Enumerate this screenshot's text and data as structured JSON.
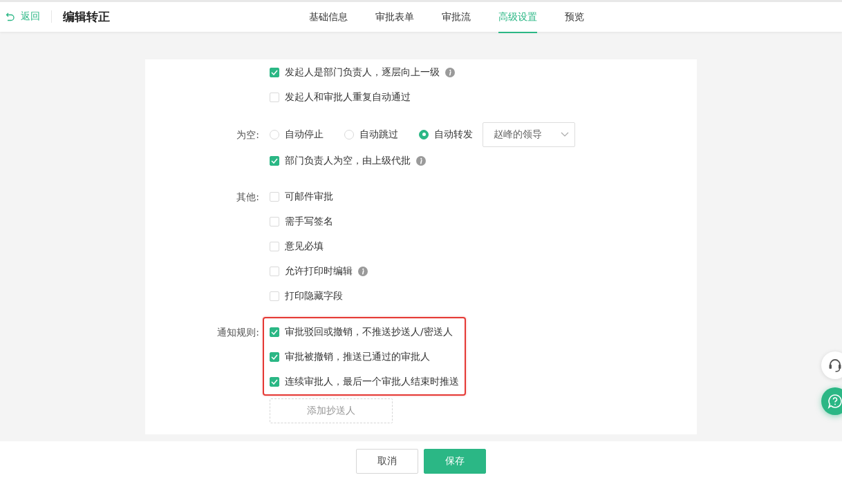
{
  "header": {
    "back": "返回",
    "title": "编辑转正",
    "tabs": [
      {
        "label": "基础信息",
        "selected": false
      },
      {
        "label": "审批表单",
        "selected": false
      },
      {
        "label": "审批流",
        "selected": false
      },
      {
        "label": "高级设置",
        "selected": true
      },
      {
        "label": "预览",
        "selected": false
      }
    ]
  },
  "sections": [
    {
      "items": [
        {
          "kind": "checkbox",
          "label": "发起人是部门负责人，逐层向上一级",
          "checked": true,
          "info": true
        },
        {
          "kind": "checkbox",
          "label": "发起人和审批人重复自动通过",
          "checked": false
        }
      ]
    },
    {
      "label": "为空:",
      "items": [
        {
          "kind": "radio_group",
          "options": [
            {
              "label": "自动停止",
              "selected": false
            },
            {
              "label": "自动跳过",
              "selected": false
            },
            {
              "label": "自动转发",
              "selected": true
            }
          ],
          "select": {
            "value": "赵峰的领导"
          }
        },
        {
          "kind": "checkbox",
          "label": "部门负责人为空，由上级代批",
          "checked": true,
          "info": true
        }
      ]
    },
    {
      "label": "其他:",
      "items": [
        {
          "kind": "checkbox",
          "label": "可邮件审批",
          "checked": false
        },
        {
          "kind": "checkbox",
          "label": "需手写签名",
          "checked": false
        },
        {
          "kind": "checkbox",
          "label": "意见必填",
          "checked": false
        },
        {
          "kind": "checkbox",
          "label": "允许打印时编辑",
          "checked": false,
          "info": true
        },
        {
          "kind": "checkbox",
          "label": "打印隐藏字段",
          "checked": false
        }
      ]
    },
    {
      "label": "通知规则:",
      "highlighted": true,
      "items": [
        {
          "kind": "checkbox",
          "label": "审批驳回或撤销，不推送抄送人/密送人",
          "checked": true
        },
        {
          "kind": "checkbox",
          "label": "审批被撤销，推送已通过的审批人",
          "checked": true
        },
        {
          "kind": "checkbox",
          "label": "连续审批人，最后一个审批人结束时推送",
          "checked": true
        }
      ],
      "add_button": "添加抄送人"
    }
  ],
  "footer": {
    "cancel": "取消",
    "save": "保存"
  }
}
